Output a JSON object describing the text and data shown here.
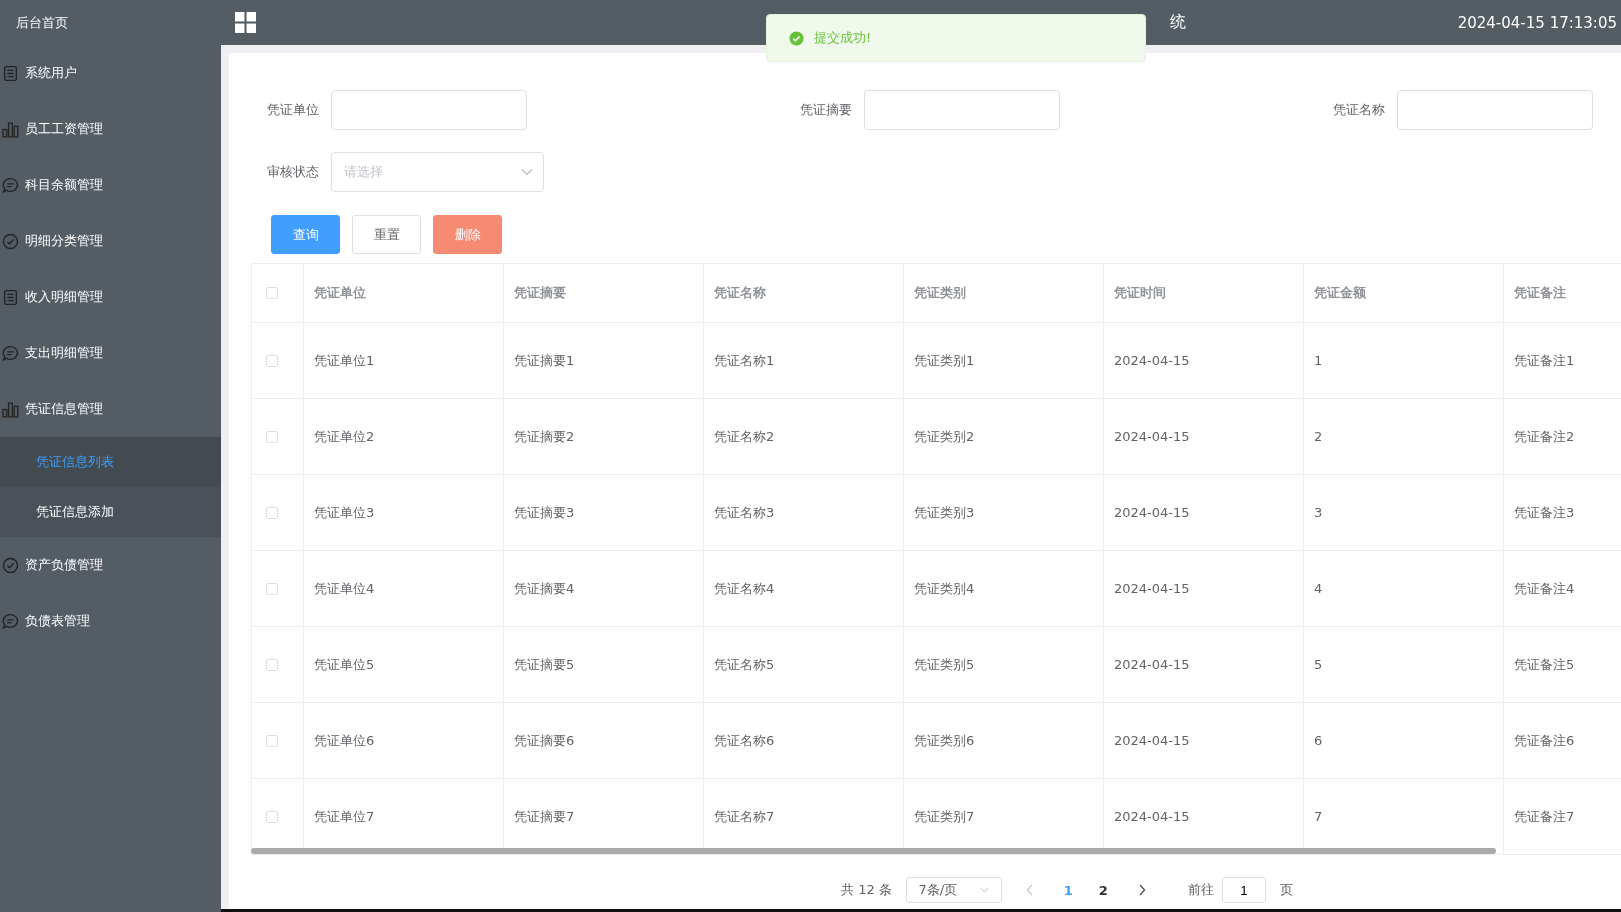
{
  "sidebar": {
    "home": "后台首页",
    "items": [
      {
        "label": "系统用户",
        "kind": "document"
      },
      {
        "label": "员工工资管理",
        "kind": "bars"
      },
      {
        "label": "科目余额管理",
        "kind": "chat"
      },
      {
        "label": "明细分类管理",
        "kind": "check"
      },
      {
        "label": "收入明细管理",
        "kind": "document"
      },
      {
        "label": "支出明细管理",
        "kind": "chat"
      },
      {
        "label": "凭证信息管理",
        "kind": "bars",
        "children": [
          {
            "label": "凭证信息列表",
            "selected": true
          },
          {
            "label": "凭证信息添加",
            "selected": false
          }
        ]
      },
      {
        "label": "资产负债管理",
        "kind": "check"
      },
      {
        "label": "负债表管理",
        "kind": "chat"
      }
    ]
  },
  "header": {
    "title": "统",
    "datetime": "2024-04-15 17:13:05"
  },
  "toast": {
    "message": "提交成功!"
  },
  "filters": [
    {
      "label": "凭证单位",
      "kind": "input"
    },
    {
      "label": "凭证摘要",
      "kind": "input"
    },
    {
      "label": "凭证名称",
      "kind": "input"
    },
    {
      "label": "审核状态",
      "kind": "select",
      "placeholder": "请选择"
    }
  ],
  "buttons": [
    {
      "label": "查询",
      "kind": "primary"
    },
    {
      "label": "重置",
      "kind": "default"
    },
    {
      "label": "删除",
      "kind": "danger"
    }
  ],
  "table": {
    "header_checked": false,
    "columns": [
      "凭证单位",
      "凭证摘要",
      "凭证名称",
      "凭证类别",
      "凭证时间",
      "凭证金额",
      "凭证备注"
    ],
    "rows": [
      {
        "selected": false,
        "cells": [
          "凭证单位1",
          "凭证摘要1",
          "凭证名称1",
          "凭证类别1",
          "2024-04-15",
          "1",
          "凭证备注1"
        ]
      },
      {
        "selected": false,
        "cells": [
          "凭证单位2",
          "凭证摘要2",
          "凭证名称2",
          "凭证类别2",
          "2024-04-15",
          "2",
          "凭证备注2"
        ]
      },
      {
        "selected": false,
        "cells": [
          "凭证单位3",
          "凭证摘要3",
          "凭证名称3",
          "凭证类别3",
          "2024-04-15",
          "3",
          "凭证备注3"
        ]
      },
      {
        "selected": false,
        "cells": [
          "凭证单位4",
          "凭证摘要4",
          "凭证名称4",
          "凭证类别4",
          "2024-04-15",
          "4",
          "凭证备注4"
        ]
      },
      {
        "selected": false,
        "cells": [
          "凭证单位5",
          "凭证摘要5",
          "凭证名称5",
          "凭证类别5",
          "2024-04-15",
          "5",
          "凭证备注5"
        ]
      },
      {
        "selected": false,
        "cells": [
          "凭证单位6",
          "凭证摘要6",
          "凭证名称6",
          "凭证类别6",
          "2024-04-15",
          "6",
          "凭证备注6"
        ]
      },
      {
        "selected": false,
        "cells": [
          "凭证单位7",
          "凭证摘要7",
          "凭证名称7",
          "凭证类别7",
          "2024-04-15",
          "7",
          "凭证备注7"
        ]
      }
    ]
  },
  "pagination": {
    "total": "共 12 条",
    "page_size": "7条/页",
    "pages": [
      {
        "label": "1",
        "selected": true
      },
      {
        "label": "2",
        "selected": false
      }
    ],
    "goto_label": "前往",
    "goto_value": "1",
    "goto_unit": "页"
  }
}
